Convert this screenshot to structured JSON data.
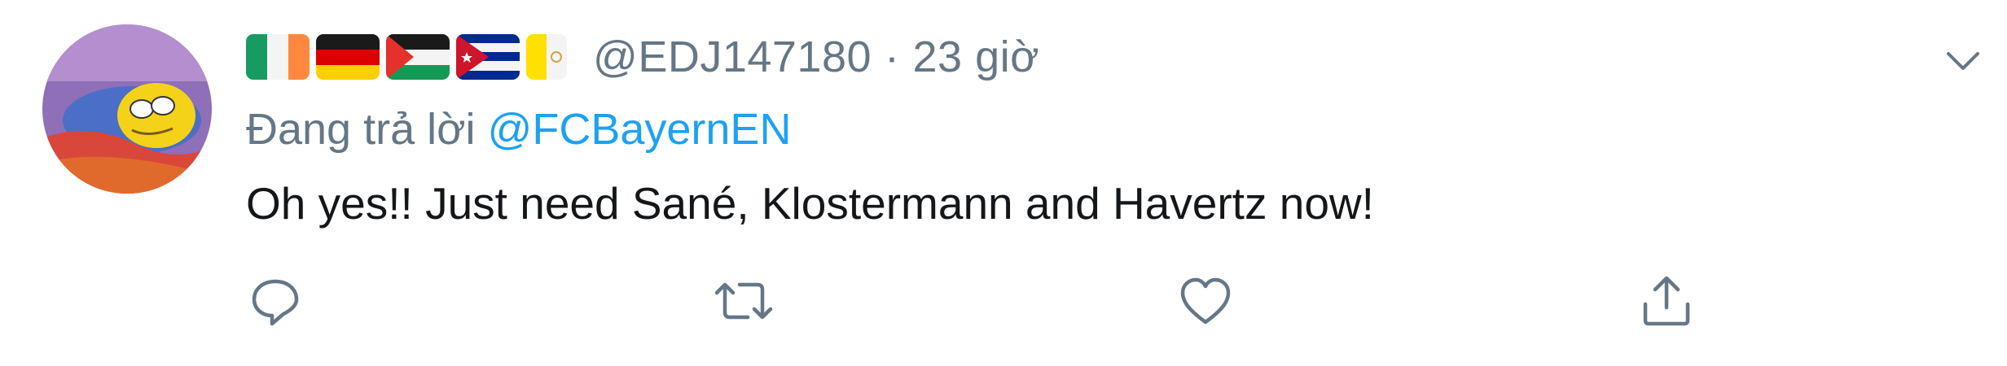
{
  "tweet": {
    "handle": "@EDJ147180",
    "separator": "·",
    "time": "23 giờ",
    "reply_prefix": "Đang trả lời ",
    "reply_to": "@FCBayernEN",
    "text": "Oh yes!! Just need Sané, Klostermann and Havertz now!"
  },
  "flags": [
    "ireland-flag",
    "germany-flag",
    "palestine-flag",
    "cuba-flag",
    "vatican-flag"
  ],
  "icons": {
    "more": "chevron-down-icon",
    "reply": "reply-icon",
    "retweet": "retweet-icon",
    "like": "heart-icon",
    "share": "share-icon"
  },
  "colors": {
    "secondary_text": "#657786",
    "link": "#1da1f2",
    "body_text": "#14171a"
  }
}
